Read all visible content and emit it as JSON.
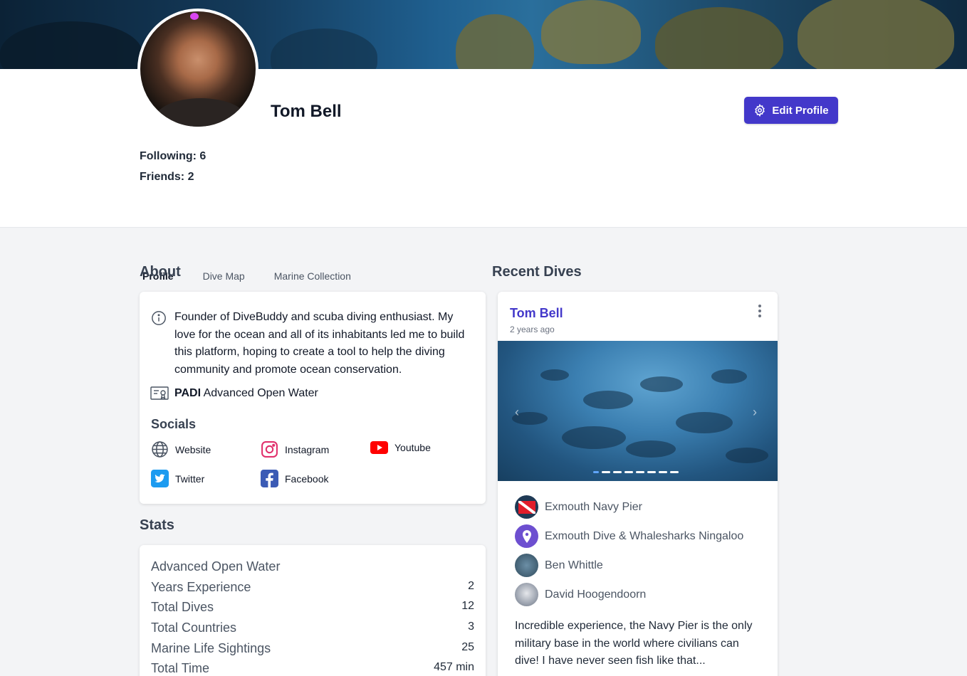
{
  "profile": {
    "name": "Tom Bell",
    "edit_button": "Edit Profile",
    "following": "Following: 6",
    "friends": "Friends: 2"
  },
  "tabs": [
    {
      "label": "Profile",
      "active": true
    },
    {
      "label": "Dive Map",
      "active": false
    },
    {
      "label": "Marine Collection",
      "active": false
    }
  ],
  "about": {
    "heading": "About",
    "bio": "Founder of DiveBuddy and scuba diving enthusiast. My love for the ocean and all of its inhabitants led me to build this platform, hoping to create a tool to help the diving community and promote ocean conservation.",
    "cert_agency": "PADI",
    "cert_level": "Advanced Open Water",
    "socials_heading": "Socials",
    "socials": [
      {
        "label": "Website",
        "icon": "globe-icon"
      },
      {
        "label": "Instagram",
        "icon": "instagram-icon"
      },
      {
        "label": "Youtube",
        "icon": "youtube-icon"
      },
      {
        "label": "Twitter",
        "icon": "twitter-icon"
      },
      {
        "label": "Facebook",
        "icon": "facebook-icon"
      }
    ]
  },
  "stats": {
    "heading": "Stats",
    "cert": "Advanced Open Water",
    "rows": [
      {
        "label": "Years Experience",
        "value": "2"
      },
      {
        "label": "Total Dives",
        "value": "12"
      },
      {
        "label": "Total Countries",
        "value": "3"
      },
      {
        "label": "Marine Life Sightings",
        "value": "25"
      },
      {
        "label": "Total Time",
        "value": "457 min"
      }
    ]
  },
  "recent_dives": {
    "heading": "Recent Dives",
    "dive": {
      "author": "Tom Bell",
      "time_ago": "2 years ago",
      "slides_total": 8,
      "slide_active": 1,
      "site": "Exmouth Navy Pier",
      "operator": "Exmouth Dive & Whalesharks Ningaloo",
      "buddies": [
        "Ben Whittle",
        "David Hoogendoorn"
      ],
      "description": "Incredible experience, the Navy Pier is the only military base in the world where civilians can dive! I have never seen fish like that..."
    }
  },
  "colors": {
    "accent": "#4338ca",
    "tab_underline": "#38a3d8",
    "page_bg": "#f3f4f6"
  }
}
